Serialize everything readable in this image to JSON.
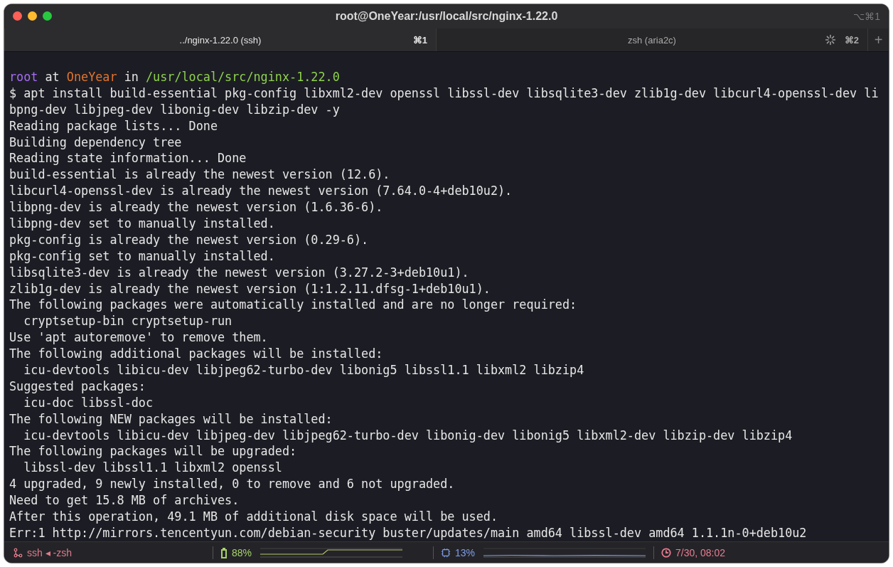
{
  "window": {
    "title": "root@OneYear:/usr/local/src/nginx-1.22.0",
    "shortcut": "⌥⌘1"
  },
  "tabs": [
    {
      "label": "../nginx-1.22.0 (ssh)",
      "shortcut": "⌘1",
      "selected": true,
      "busy": false
    },
    {
      "label": "zsh (aria2c)",
      "shortcut": "⌘2",
      "selected": false,
      "busy": true
    }
  ],
  "new_tab": "+",
  "prompt": {
    "user": "root",
    "at": "at",
    "host": "OneYear",
    "in": "in",
    "path": "/usr/local/src/nginx-1.22.0"
  },
  "lines": [
    "$ apt install build-essential pkg-config libxml2-dev openssl libssl-dev libsqlite3-dev zlib1g-dev libcurl4-openssl-dev li",
    "bpng-dev libjpeg-dev libonig-dev libzip-dev -y",
    "Reading package lists... Done",
    "Building dependency tree",
    "Reading state information... Done",
    "build-essential is already the newest version (12.6).",
    "libcurl4-openssl-dev is already the newest version (7.64.0-4+deb10u2).",
    "libpng-dev is already the newest version (1.6.36-6).",
    "libpng-dev set to manually installed.",
    "pkg-config is already the newest version (0.29-6).",
    "pkg-config set to manually installed.",
    "libsqlite3-dev is already the newest version (3.27.2-3+deb10u1).",
    "zlib1g-dev is already the newest version (1:1.2.11.dfsg-1+deb10u1).",
    "The following packages were automatically installed and are no longer required:",
    "  cryptsetup-bin cryptsetup-run",
    "Use 'apt autoremove' to remove them.",
    "The following additional packages will be installed:",
    "  icu-devtools libicu-dev libjpeg62-turbo-dev libonig5 libssl1.1 libxml2 libzip4",
    "Suggested packages:",
    "  icu-doc libssl-doc",
    "The following NEW packages will be installed:",
    "  icu-devtools libicu-dev libjpeg-dev libjpeg62-turbo-dev libonig-dev libonig5 libxml2-dev libzip-dev libzip4",
    "The following packages will be upgraded:",
    "  libssl-dev libssl1.1 libxml2 openssl",
    "4 upgraded, 9 newly installed, 0 to remove and 6 not upgraded.",
    "Need to get 15.8 MB of archives.",
    "After this operation, 49.1 MB of additional disk space will be used.",
    "Err:1 http://mirrors.tencentyun.com/debian-security buster/updates/main amd64 libssl-dev amd64 1.1.1n-0+deb10u2"
  ],
  "status_bar": [
    {
      "kind": "session",
      "text": "ssh ◂ -zsh",
      "color": "#e07a8a"
    },
    {
      "kind": "battery",
      "text": "88%",
      "color": "#a6d16a"
    },
    {
      "kind": "cpu",
      "text": "13%",
      "color": "#7f9ee6"
    },
    {
      "kind": "clock",
      "text": "7/30, 08:02",
      "color": "#ea7b90"
    }
  ]
}
